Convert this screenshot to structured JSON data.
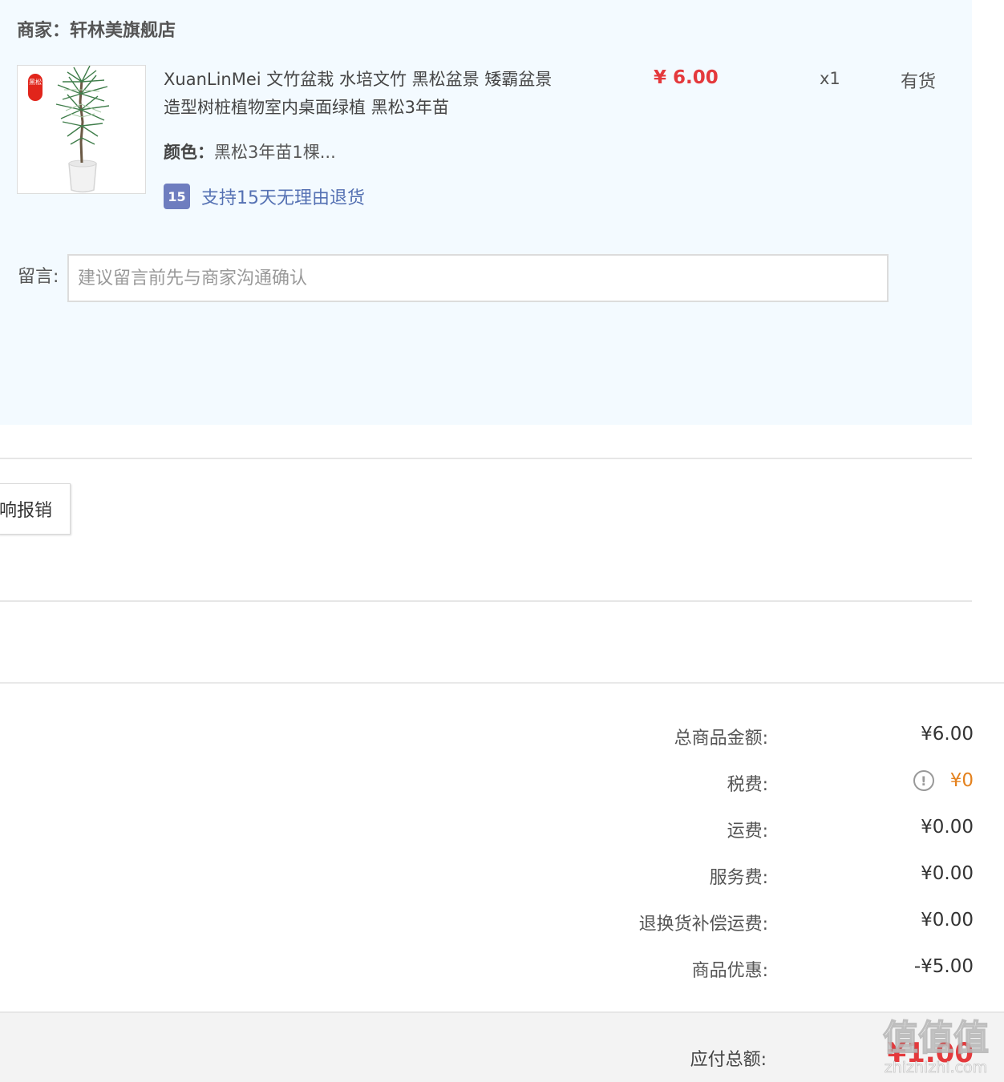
{
  "order": {
    "merchant": "商家：轩林美旗舰店",
    "product": {
      "badge_text": "黑松",
      "title": "XuanLinMei 文竹盆栽 水培文竹 黑松盆景 矮霸盆景造型树桩植物室内桌面绿植 黑松3年苗",
      "price": "¥ 6.00",
      "qty": "x1",
      "stock": "有货",
      "color_label": "颜色：",
      "color_value": "黑松3年苗1棵...",
      "return_icon_text": "15",
      "return_policy": "支持15天无理由退货"
    },
    "message": {
      "label": "留言:",
      "placeholder": "建议留言前先与商家沟通确认",
      "value": ""
    }
  },
  "invoice": {
    "button_label": "响报销"
  },
  "summary": {
    "rows": [
      {
        "label": "总商品金额:",
        "value": "¥6.00"
      },
      {
        "label": "税费:",
        "value": "¥0",
        "icon": "info-icon",
        "icon_glyph": "!"
      },
      {
        "label": "运费:",
        "value": "¥0.00"
      },
      {
        "label": "服务费:",
        "value": "¥0.00"
      },
      {
        "label": "退换货补偿运费:",
        "value": "¥0.00"
      },
      {
        "label": "商品优惠:",
        "value": "-¥5.00"
      }
    ],
    "total_label": "应付总额:",
    "total_value": "¥1.00"
  },
  "watermark": {
    "main": "值值值",
    "site": "zhizhizhi.com"
  },
  "colors": {
    "card_bg": "#f3faff",
    "price_red": "#e4393c",
    "tax_orange": "#e4821e",
    "link_blue": "#5571b3"
  }
}
